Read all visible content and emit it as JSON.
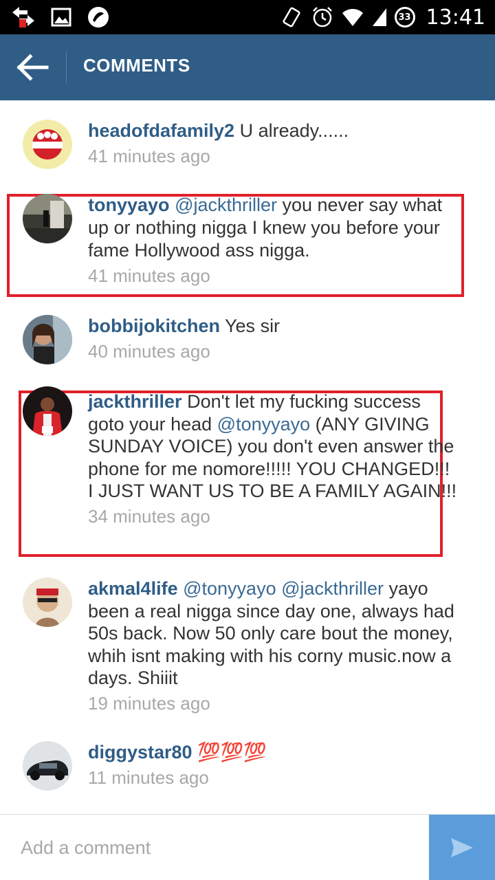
{
  "status_bar": {
    "time": "13:41",
    "battery_level": "33"
  },
  "header": {
    "title": "COMMENTS"
  },
  "comments": [
    {
      "username": "headofdafamily2",
      "parts": [
        {
          "t": "U already......",
          "m": false
        }
      ],
      "time": "41 minutes ago",
      "highlighted": false
    },
    {
      "username": "tonyyayo",
      "parts": [
        {
          "t": "@jackthriller",
          "m": true
        },
        {
          "t": " you never say what up or nothing nigga I knew you before your fame Hollywood ass nigga.",
          "m": false
        }
      ],
      "time": "41 minutes ago",
      "highlighted": true
    },
    {
      "username": "bobbijokitchen",
      "parts": [
        {
          "t": "Yes sir",
          "m": false
        }
      ],
      "time": "40 minutes ago",
      "highlighted": false
    },
    {
      "username": "jackthriller",
      "parts": [
        {
          "t": "Don't let my fucking success goto your head ",
          "m": false
        },
        {
          "t": "@tonyyayo",
          "m": true
        },
        {
          "t": " (ANY GIVING SUNDAY VOICE) you don't even answer the phone for me nomore!!!!! YOU CHANGED!!! I JUST WANT US TO BE A FAMILY AGAIN!!!",
          "m": false
        }
      ],
      "time": "34 minutes ago",
      "highlighted": true
    },
    {
      "username": "akmal4life",
      "parts": [
        {
          "t": "@tonyyayo",
          "m": true
        },
        {
          "t": " ",
          "m": false
        },
        {
          "t": "@jackthriller",
          "m": true
        },
        {
          "t": " yayo been a real nigga since day one, always had 50s back. Now 50 only care bout the money, whih isnt making with his corny music.now a days. Shiiit",
          "m": false
        }
      ],
      "time": "19 minutes ago",
      "highlighted": false
    },
    {
      "username": "diggystar80",
      "parts": [
        {
          "t": "💯💯💯",
          "m": false,
          "e": true
        }
      ],
      "time": "11 minutes ago",
      "highlighted": false
    }
  ],
  "input": {
    "placeholder": "Add a comment"
  },
  "colors": {
    "header": "#2f5d86",
    "username": "#2f5d86",
    "timestamp": "#a8a8a8",
    "highlight_border": "#e0202a",
    "send_button": "#5b9ddb"
  }
}
